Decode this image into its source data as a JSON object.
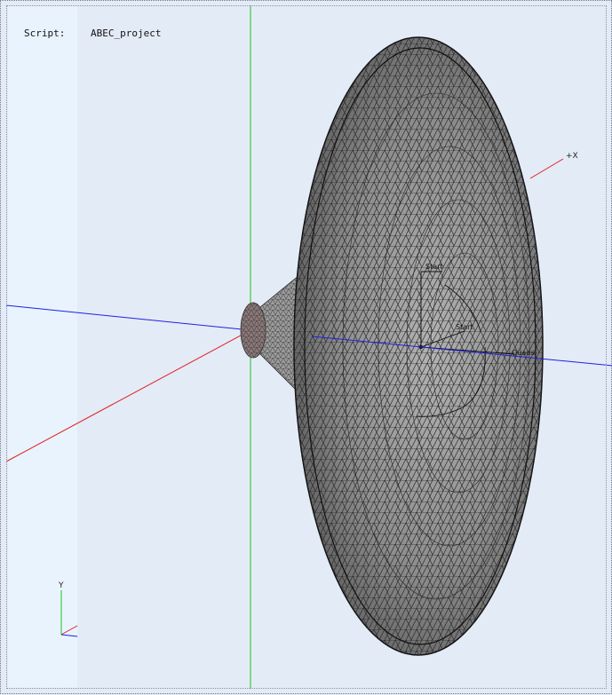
{
  "script": {
    "label": "Script:",
    "name": "ABEC_project"
  },
  "axes": {
    "x_label": "+X",
    "y_label": "Y"
  },
  "mesh_labels": {
    "start_top": "Start",
    "start_mid": "Start",
    "quad": "Quads"
  },
  "colors": {
    "background": "#e3ebf7",
    "left_panel": "#e8f3fd",
    "x_axis": "#e02020",
    "y_axis": "#20c020",
    "z_axis": "#2020e0",
    "mesh_fill": "#8c8c8c",
    "mesh_line": "#222222"
  }
}
